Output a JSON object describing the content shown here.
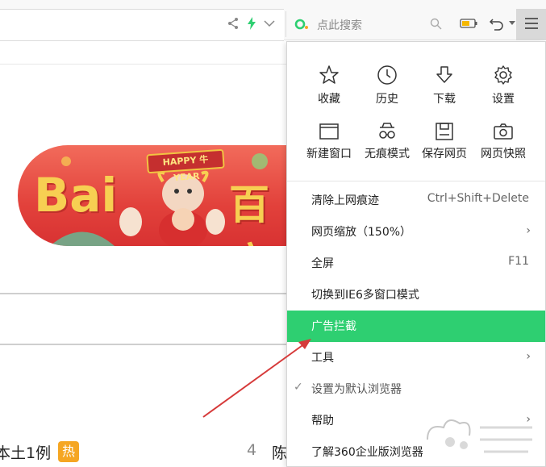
{
  "search": {
    "placeholder": "点此搜索"
  },
  "menu": {
    "grid": [
      {
        "label": "收藏",
        "icon": "star-icon"
      },
      {
        "label": "历史",
        "icon": "clock-icon"
      },
      {
        "label": "下载",
        "icon": "download-icon"
      },
      {
        "label": "设置",
        "icon": "gear-icon"
      },
      {
        "label": "新建窗口",
        "icon": "window-icon"
      },
      {
        "label": "无痕模式",
        "icon": "incognito-icon"
      },
      {
        "label": "保存网页",
        "icon": "save-icon"
      },
      {
        "label": "网页快照",
        "icon": "camera-icon"
      }
    ],
    "items": [
      {
        "label": "清除上网痕迹",
        "shortcut": "Ctrl+Shift+Delete"
      },
      {
        "label": "网页缩放（150%）",
        "submenu": "›"
      },
      {
        "label": "全屏",
        "shortcut": "F11"
      },
      {
        "label": "切换到IE6多窗口模式"
      },
      {
        "label": "广告拦截",
        "highlighted": true
      },
      {
        "label": "工具",
        "submenu": "›"
      },
      {
        "label": "设置为默认浏览器",
        "checked": true,
        "check": "✓"
      },
      {
        "label": "帮助",
        "submenu": "›"
      },
      {
        "label": "了解360企业版浏览器"
      }
    ]
  },
  "doodle": {
    "logo": "Bai",
    "hanzi": "百度",
    "ribbon": "HAPPY 牛 YEAR"
  },
  "hotlist": {
    "left_text": "本土1例",
    "badge": "热",
    "rank": "4",
    "right_text": "陈"
  },
  "colors": {
    "highlight": "#2ecf71",
    "annotation_arrow": "#d63a3a",
    "menu_button_bg": "#d9d9d9"
  }
}
